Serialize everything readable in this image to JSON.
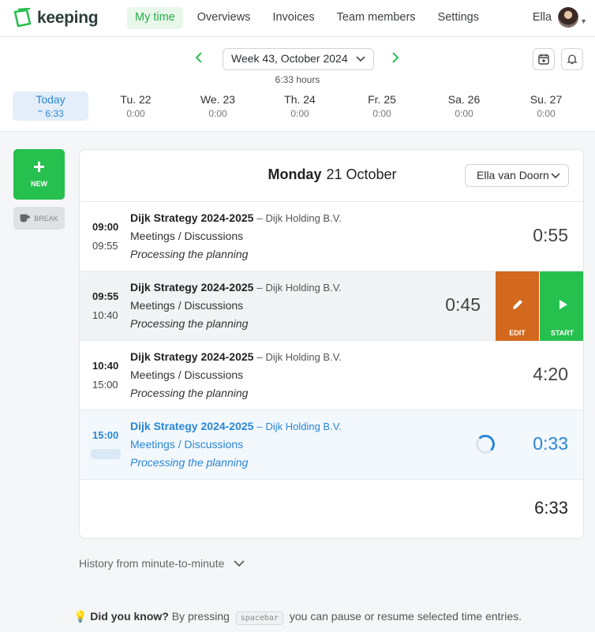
{
  "app": {
    "name": "keeping",
    "accent": "#26c04f"
  },
  "nav": {
    "items": [
      {
        "label": "My time",
        "active": true
      },
      {
        "label": "Overviews"
      },
      {
        "label": "Invoices"
      },
      {
        "label": "Team members"
      },
      {
        "label": "Settings"
      }
    ],
    "user": "Ella"
  },
  "week": {
    "label": "Week 43, October 2024",
    "hours": "6:33 hours",
    "days": [
      {
        "name": "Today",
        "time": "6:33"
      },
      {
        "name": "Tu. 22",
        "time": "0:00"
      },
      {
        "name": "We. 23",
        "time": "0:00"
      },
      {
        "name": "Th. 24",
        "time": "0:00"
      },
      {
        "name": "Fr. 25",
        "time": "0:00"
      },
      {
        "name": "Sa. 26",
        "time": "0:00"
      },
      {
        "name": "Su. 27",
        "time": "0:00"
      }
    ]
  },
  "actions": {
    "new": "NEW",
    "break": "BREAK"
  },
  "day": {
    "weekday": "Monday",
    "date": "21 October",
    "person": "Ella van Doorn",
    "total": "6:33",
    "entries": [
      {
        "start": "09:00",
        "end": "09:55",
        "project": "Dijk Strategy 2024-2025",
        "sep": "–",
        "client": "Dijk Holding B.V.",
        "task": "Meetings / Discussions",
        "note": "Processing the planning",
        "duration": "0:55"
      },
      {
        "start": "09:55",
        "end": "10:40",
        "project": "Dijk Strategy 2024-2025",
        "sep": "–",
        "client": "Dijk Holding B.V.",
        "task": "Meetings / Discussions",
        "note": "Processing the planning",
        "duration": "0:45",
        "edit_label": "EDIT",
        "start_label": "START"
      },
      {
        "start": "10:40",
        "end": "15:00",
        "project": "Dijk Strategy 2024-2025",
        "sep": "–",
        "client": "Dijk Holding B.V.",
        "task": "Meetings / Discussions",
        "note": "Processing the planning",
        "duration": "4:20"
      },
      {
        "start": "15:00",
        "end": "",
        "project": "Dijk Strategy 2024-2025",
        "sep": "–",
        "client": "Dijk Holding B.V.",
        "task": "Meetings / Discussions",
        "note": "Processing the planning",
        "duration": "0:33",
        "running": true
      }
    ]
  },
  "history": "History from minute-to-minute",
  "tip": {
    "title": "Did you know?",
    "before": "By pressing",
    "key": "spacebar",
    "after": "you can pause or resume selected time entries."
  }
}
